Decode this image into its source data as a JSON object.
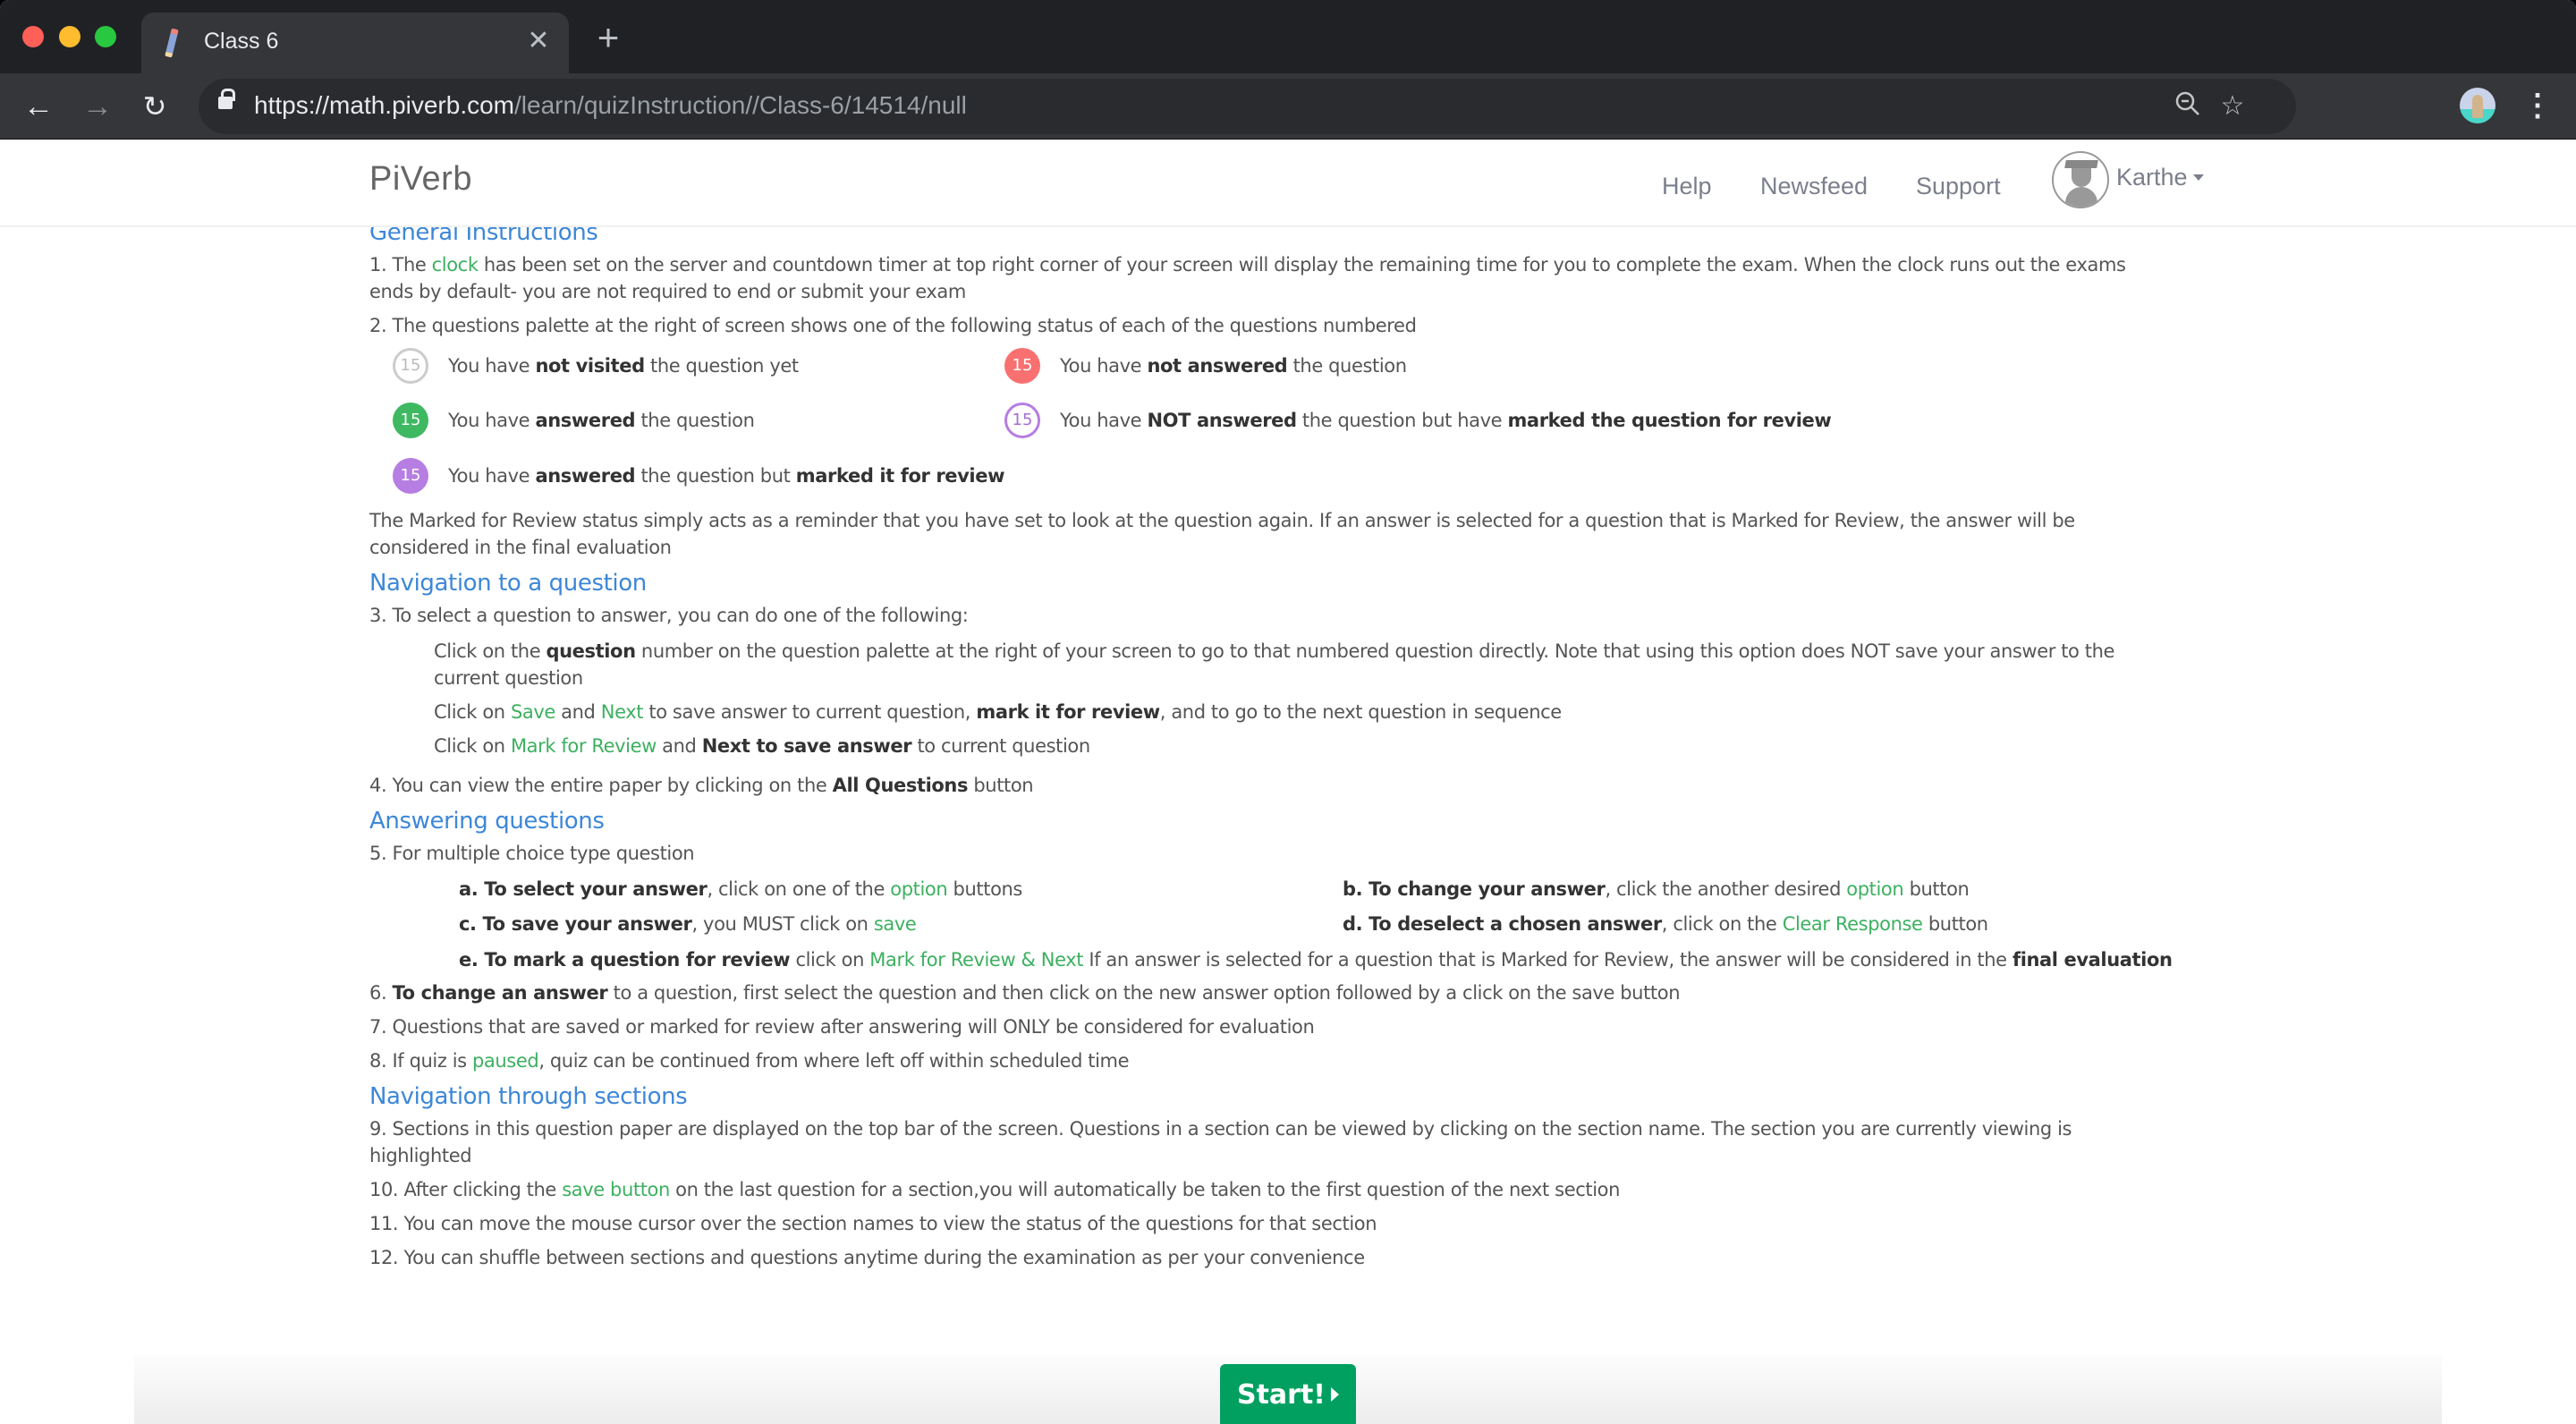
{
  "browser": {
    "tab_title": "Class 6",
    "url_host": "https://math.piverb.com",
    "url_path": "/learn/quizInstruction//Class-6/14514/null",
    "icons": {
      "back": "←",
      "forward": "→",
      "reload": "↻",
      "close": "✕",
      "new_tab": "+",
      "zoom": "🔍",
      "star": "☆",
      "menu": "⋮"
    }
  },
  "header": {
    "brand": "PiVerb",
    "nav": [
      "Help",
      "Newsfeed",
      "Support"
    ],
    "user": "Karthe"
  },
  "sections": {
    "general": "General Instructions",
    "navigation_question": "Navigation to a question",
    "answering": "Answering questions",
    "navigation_sections": "Navigation through sections"
  },
  "instructions": {
    "i1": {
      "pre": "1. The ",
      "link": "clock",
      "post": " has been set on the server and countdown timer at top right corner of your screen will display the remaining time for you to complete the exam. When the clock runs out the exams ends by default- you are not required to end or submit your exam"
    },
    "i2": "2. The questions palette at the right of screen shows one of the following status of each of the questions numbered",
    "legend": [
      {
        "number": "15",
        "status": "not-visited",
        "pre": "You have ",
        "bold": "not visited",
        "post": " the question yet",
        "color": "#cccccc"
      },
      {
        "number": "15",
        "status": "not-answered",
        "pre": "You have ",
        "bold": "not answered",
        "post": " the question",
        "color": "#f87170"
      },
      {
        "number": "15",
        "status": "answered",
        "pre": "You have ",
        "bold": "answered",
        "post": " the question",
        "color": "#3fb862"
      },
      {
        "number": "15",
        "status": "marked-not-answered",
        "pre": "You have ",
        "bold": "NOT answered",
        "post": " the question but have ",
        "bold2": "marked the question for review",
        "color": "#b67de2"
      },
      {
        "number": "15",
        "status": "answered-marked",
        "pre": "You have ",
        "bold": "answered",
        "post": " the question but ",
        "bold2": "marked it for review",
        "color": "#b67de2"
      }
    ],
    "review_note": "The Marked for Review status simply acts as a reminder that you have set to look at the question again. If an answer is selected for a question that is Marked for Review, the answer will be considered in the final evaluation",
    "i3": "3. To select a question to answer, you can do one of the following:",
    "i3_options": {
      "a": {
        "pre": "Click on the ",
        "bold": "question",
        "post": " number on the question palette at the right of your screen to go to that numbered question directly. Note that using this option does NOT save your answer to the current question"
      },
      "b": {
        "pre": "Click on ",
        "link1": "Save",
        "mid": " and ",
        "link2": "Next",
        "post": " to save answer to current question, ",
        "bold": "mark it for review",
        "post2": ", and to go to the next question in sequence"
      },
      "c": {
        "pre": "Click on ",
        "link": "Mark for Review",
        "mid": " and ",
        "bold": "Next to save answer",
        "post": " to current question"
      }
    },
    "i4": {
      "pre": "4. You can view the entire paper by clicking on the ",
      "bold": "All Questions",
      "post": " button"
    },
    "i5": "5. For multiple choice type question",
    "i5_options": {
      "a": {
        "bold": "a. To select your answer",
        "pre": ", click on one of the ",
        "link": "option",
        "post": " buttons"
      },
      "b": {
        "bold": "b. To change your answer",
        "pre": ", click the another desired ",
        "link": "option",
        "post": " button"
      },
      "c": {
        "bold": "c. To save your answer",
        "pre": ", you MUST click on ",
        "link": "save",
        "post": ""
      },
      "d": {
        "bold": "d. To deselect a chosen answer",
        "pre": ", click on the ",
        "link": "Clear Response",
        "post": " button"
      },
      "e": {
        "bold": "e. To mark a question for review",
        "pre": " click on ",
        "link": "Mark for Review & Next",
        "post": " If an answer is selected for a question that is Marked for Review, the answer will be considered in the ",
        "bold2": "final evaluation"
      }
    },
    "i6": {
      "pre": "6. ",
      "bold": "To change an answer",
      "post": " to a question, first select the question and then click on the new answer option followed by a click on the save button"
    },
    "i7": "7. Questions that are saved or marked for review after answering will ONLY be considered for evaluation",
    "i8": {
      "pre": "8. If quiz is ",
      "link": "paused",
      "post": ", quiz can be continued from where left off within scheduled time"
    },
    "i9": "9. Sections in this question paper are displayed on the top bar of the screen. Questions in a section can be viewed by clicking on the section name. The section you are currently viewing is highlighted",
    "i10": {
      "pre": "10. After clicking the ",
      "link": "save button",
      "post": " on the last question for a section,you will automatically be taken to the first question of the next section"
    },
    "i11": "11. You can move the mouse cursor over the section names to view the status of the questions for that section",
    "i12": "12. You can shuffle between sections and questions anytime during the examination as per your convenience"
  },
  "start_button": "Start!",
  "colors": {
    "accent_blue": "#3d87d8",
    "link_green": "#3db060",
    "start_green": "#02a060"
  }
}
